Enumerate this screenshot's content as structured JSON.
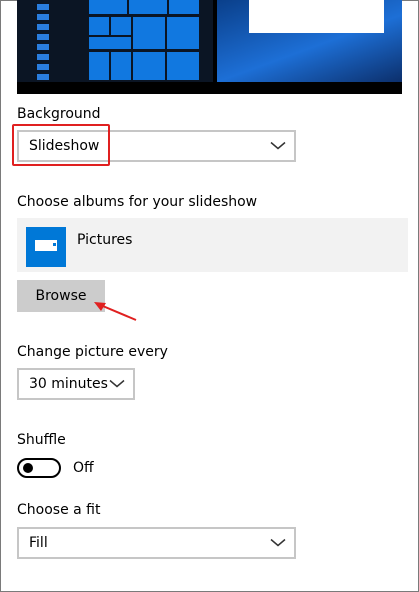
{
  "preview": {
    "accent": "#1178e0"
  },
  "background": {
    "label": "Background",
    "value": "Slideshow"
  },
  "albums": {
    "label": "Choose albums for your slideshow",
    "items": [
      {
        "name": "Pictures"
      }
    ],
    "browse_label": "Browse"
  },
  "interval": {
    "label": "Change picture every",
    "value": "30 minutes"
  },
  "shuffle": {
    "label": "Shuffle",
    "state_label": "Off",
    "on": false
  },
  "fit": {
    "label": "Choose a fit",
    "value": "Fill"
  },
  "annotation": {
    "color": "#e02020"
  }
}
